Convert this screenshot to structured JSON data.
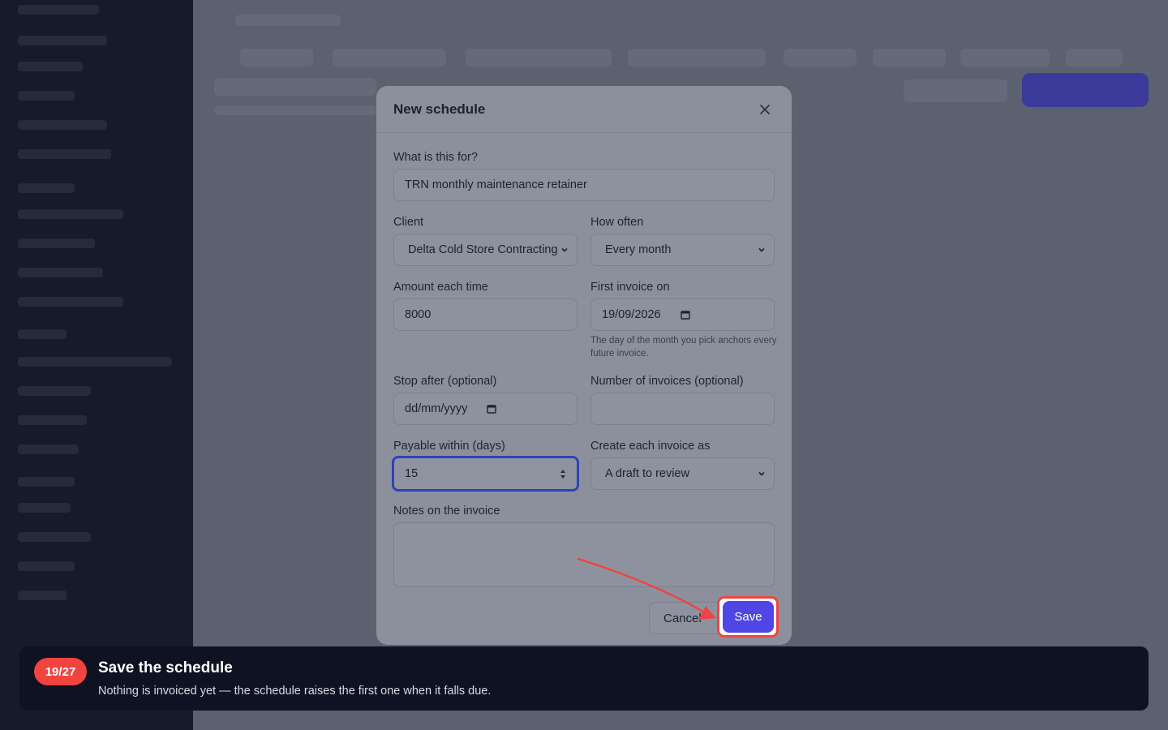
{
  "modal": {
    "title": "New schedule",
    "fields": {
      "purpose": {
        "label": "What is this for?",
        "value": "TRN monthly maintenance retainer"
      },
      "client": {
        "label": "Client",
        "value": "Delta Cold Store Contracting"
      },
      "frequency": {
        "label": "How often",
        "value": "Every month"
      },
      "amount": {
        "label": "Amount each time",
        "value": "8000"
      },
      "first_invoice": {
        "label": "First invoice on",
        "value": "19/09/2026",
        "hint": "The day of the month you pick anchors every future invoice."
      },
      "stop_after": {
        "label": "Stop after (optional)",
        "value": "dd/mm/yyyy"
      },
      "invoice_count": {
        "label": "Number of invoices (optional)",
        "value": ""
      },
      "payable_within": {
        "label": "Payable within (days)",
        "value": "15"
      },
      "create_as": {
        "label": "Create each invoice as",
        "value": "A draft to review"
      },
      "notes": {
        "label": "Notes on the invoice",
        "value": ""
      }
    },
    "buttons": {
      "cancel": "Cancel",
      "save": "Save"
    }
  },
  "tour": {
    "step": "19/27",
    "title": "Save the schedule",
    "text": "Nothing is invoiced yet — the schedule raises the first one when it falls due."
  },
  "colors": {
    "accent": "#4f46e5",
    "highlight": "#ef4444",
    "tour_bg": "#0f1222",
    "badge": "#f2443f"
  }
}
